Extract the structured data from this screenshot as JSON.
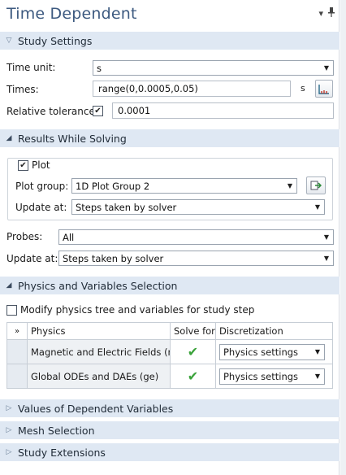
{
  "window": {
    "title": "Time Dependent",
    "menu_icon": "▾",
    "pin_icon": "📌"
  },
  "study_settings": {
    "header": "Study Settings",
    "time_unit_label": "Time unit:",
    "time_unit_value": "s",
    "times_label": "Times:",
    "times_value": "range(0,0.0005,0.05)",
    "times_unit": "s",
    "rel_tol_label": "Relative tolerance:",
    "rel_tol_value": "0.0001",
    "rel_tol_checked": true
  },
  "results_while_solving": {
    "header": "Results While Solving",
    "plot_label": "Plot",
    "plot_checked": true,
    "plot_group_label": "Plot group:",
    "plot_group_value": "1D Plot Group 2",
    "update_at_label": "Update at:",
    "update_at_value": "Steps taken by solver",
    "probes_label": "Probes:",
    "probes_value": "All",
    "update_at2_label": "Update at:",
    "update_at2_value": "Steps taken by solver"
  },
  "physics_selection": {
    "header": "Physics and Variables Selection",
    "modify_label": "Modify physics tree and variables for study step",
    "modify_checked": false,
    "table": {
      "corner": "»",
      "columns": [
        "Physics",
        "Solve for",
        "Discretization"
      ],
      "rows": [
        {
          "physics": "Magnetic and Electric Fields (m...",
          "solve_for": true,
          "discretization": "Physics settings"
        },
        {
          "physics": "Global ODEs and DAEs (ge)",
          "solve_for": true,
          "discretization": "Physics settings"
        }
      ]
    }
  },
  "collapsed_sections": [
    {
      "header": "Values of Dependent Variables"
    },
    {
      "header": "Mesh Selection"
    },
    {
      "header": "Study Extensions"
    }
  ]
}
